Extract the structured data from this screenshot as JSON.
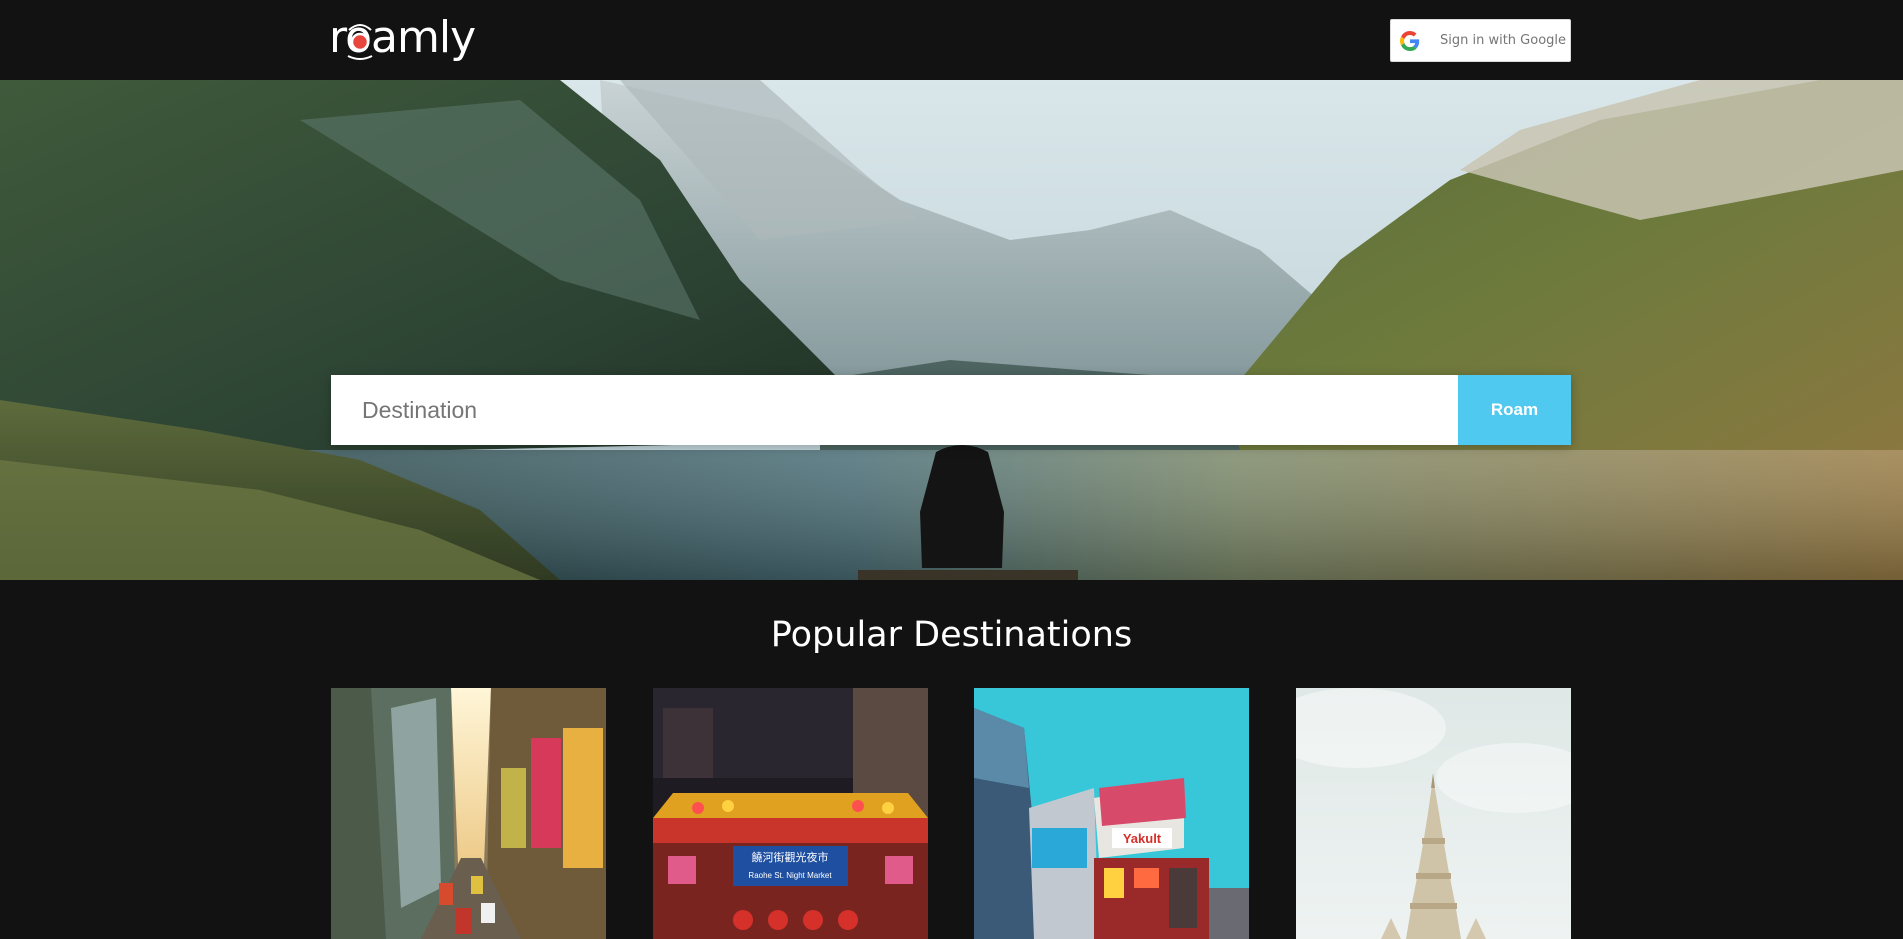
{
  "header": {
    "logo_text": "roamly",
    "signin_label": "Sign in with Google"
  },
  "hero": {
    "search_placeholder": "Destination",
    "search_value": "",
    "button_label": "Roam"
  },
  "popular": {
    "title": "Popular Destinations",
    "cards": [
      {
        "image": "hong-kong-street-photo"
      },
      {
        "image": "night-market-gate-photo",
        "sign_lines": [
          "饒河街觀光夜市",
          "Raohe St. Night Market"
        ]
      },
      {
        "image": "tokyo-billboards-photo",
        "sign_text": "Yakult"
      },
      {
        "image": "temple-spire-photo"
      }
    ]
  },
  "colors": {
    "background": "#121212",
    "accent": "#4fc9ef",
    "logo_dot": "#e8453c"
  }
}
